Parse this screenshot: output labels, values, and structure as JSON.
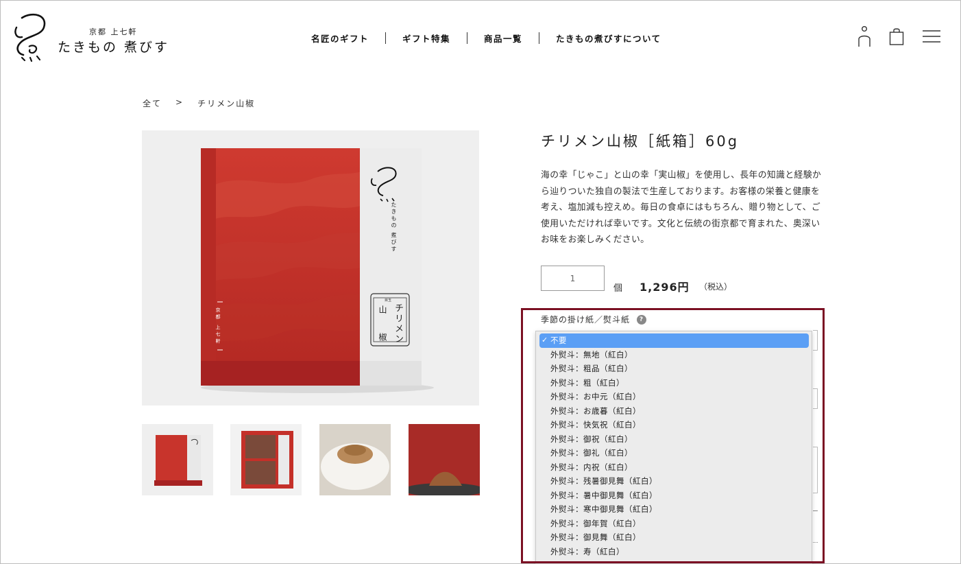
{
  "brand": {
    "small_text": "京都 上七軒",
    "name": "たきもの 煮びす"
  },
  "nav": {
    "items": [
      "名匠のギフト",
      "ギフト特集",
      "商品一覧",
      "たきもの煮びすについて"
    ]
  },
  "breadcrumb": {
    "root": "全て",
    "separator": ">",
    "current": "チリメン山椒"
  },
  "package": {
    "brand_vertical": "たきもの 煮びす",
    "location_vertical": "京都 上七軒",
    "label_small": "目玉",
    "label_left": "山 椒",
    "label_right": "チリメン"
  },
  "product": {
    "title": "チリメン山椒［紙箱］60g",
    "description": "海の幸「じゃこ」と山の幸「実山椒」を使用し、長年の知識と経験から辿りついた独自の製法で生産しております。お客様の栄養と健康を考え、塩加減も控えめ。毎日の食卓にはもちろん、贈り物として、ご使用いただければ幸いです。文化と伝統の街京都で育まれた、奥深いお味をお楽しみください。",
    "quantity": "1",
    "quantity_unit": "個",
    "price": "1,296円",
    "tax_note": "（税込）"
  },
  "noshi": {
    "label": "季節の掛け紙／熨斗紙",
    "help_icon": "?",
    "check_mark": "✓",
    "options": [
      "不要",
      "外熨斗：無地（紅白）",
      "外熨斗：粗品（紅白）",
      "外熨斗：粗（紅白）",
      "外熨斗：お中元（紅白）",
      "外熨斗：お歳暮（紅白）",
      "外熨斗：快気祝（紅白）",
      "外熨斗：御祝（紅白）",
      "外熨斗：御礼（紅白）",
      "外熨斗：内祝（紅白）",
      "外熨斗：残暑御見舞（紅白）",
      "外熨斗：暑中御見舞（紅白）",
      "外熨斗：寒中御見舞（紅白）",
      "外熨斗：御年賀（紅白）",
      "外熨斗：御見舞（紅白）",
      "外熨斗：寿（紅白）"
    ],
    "selected_index": 0
  },
  "colors": {
    "highlight_border": "#7b1023",
    "selected_option": "#5b9ff5",
    "package_red": "#c8342c"
  }
}
